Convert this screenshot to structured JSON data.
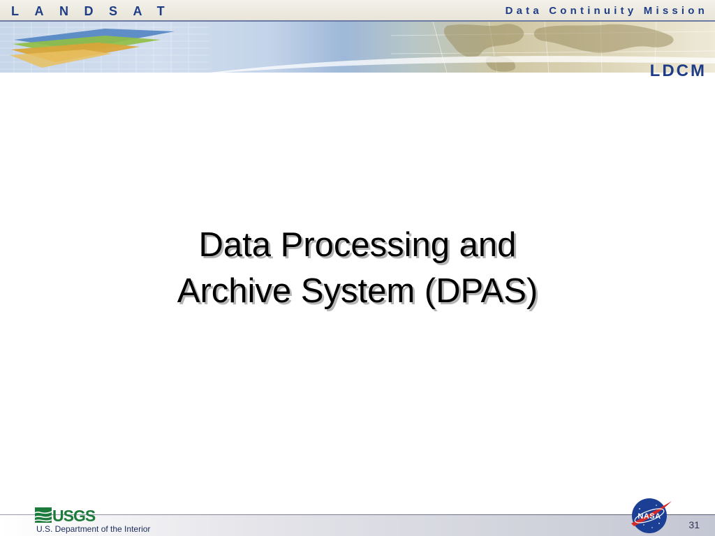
{
  "header": {
    "program_name": "LANDSAT",
    "mission_name": "Data Continuity Mission",
    "mission_logo_text": "LDCM"
  },
  "slide": {
    "title_line1": "Data Processing and",
    "title_line2": "Archive System (DPAS)",
    "page_number": "31"
  },
  "footer": {
    "agency_logo_text": "USGS",
    "department": "U.S. Department of the Interior",
    "partner_logo_text": "NASA"
  },
  "colors": {
    "brand_blue": "#1f3d86",
    "title_text": "#000000"
  }
}
